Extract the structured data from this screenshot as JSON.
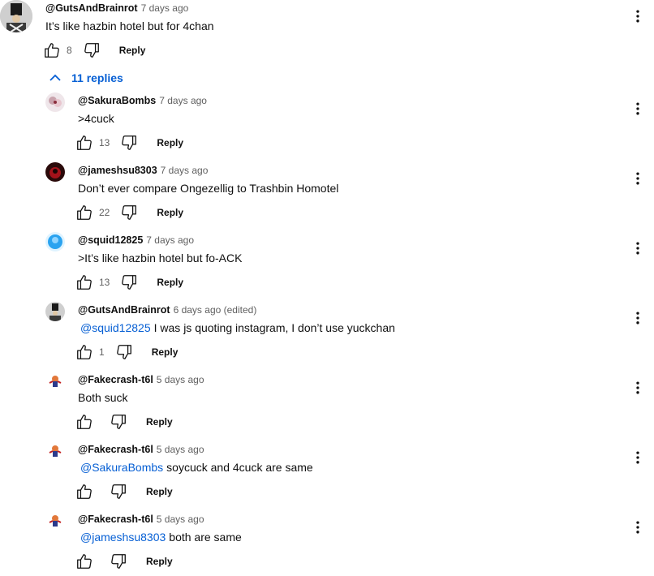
{
  "top_comment": {
    "author": "@GutsAndBrainrot",
    "timestamp": "7 days ago",
    "text": "It’s like hazbin hotel but for 4chan",
    "likes": "8",
    "reply_label": "Reply"
  },
  "replies_toggle": {
    "label": "11 replies",
    "icon": "chevron-up-icon"
  },
  "replies": [
    {
      "author": "@SakuraBombs",
      "timestamp": "7 days ago",
      "mention": "",
      "text": ">4cuck",
      "likes": "13",
      "reply_label": "Reply"
    },
    {
      "author": "@jameshsu8303",
      "timestamp": "7 days ago",
      "mention": "",
      "text": "Don’t ever compare Ongezellig to Trashbin Homotel",
      "likes": "22",
      "reply_label": "Reply"
    },
    {
      "author": "@squid12825",
      "timestamp": "7 days ago",
      "mention": "",
      "text": ">It’s like hazbin hotel but fo-ACK",
      "likes": "13",
      "reply_label": "Reply"
    },
    {
      "author": "@GutsAndBrainrot",
      "timestamp": "6 days ago (edited)",
      "mention": "@squid12825",
      "text": "I was js quoting instagram, I don’t use yuckchan",
      "likes": "1",
      "reply_label": "Reply"
    },
    {
      "author": "@Fakecrash-t6l",
      "timestamp": "5 days ago",
      "mention": "",
      "text": "Both suck",
      "likes": "",
      "reply_label": "Reply"
    },
    {
      "author": "@Fakecrash-t6l",
      "timestamp": "5 days ago",
      "mention": "@SakuraBombs",
      "text": "soycuck and 4cuck are same",
      "likes": "",
      "reply_label": "Reply"
    },
    {
      "author": "@Fakecrash-t6l",
      "timestamp": "5 days ago",
      "mention": "@jameshsu8303",
      "text": "both are same",
      "likes": "",
      "reply_label": "Reply"
    }
  ],
  "colors": {
    "link": "#065fd4",
    "secondary_text": "#606060",
    "primary_text": "#0f0f0f"
  }
}
